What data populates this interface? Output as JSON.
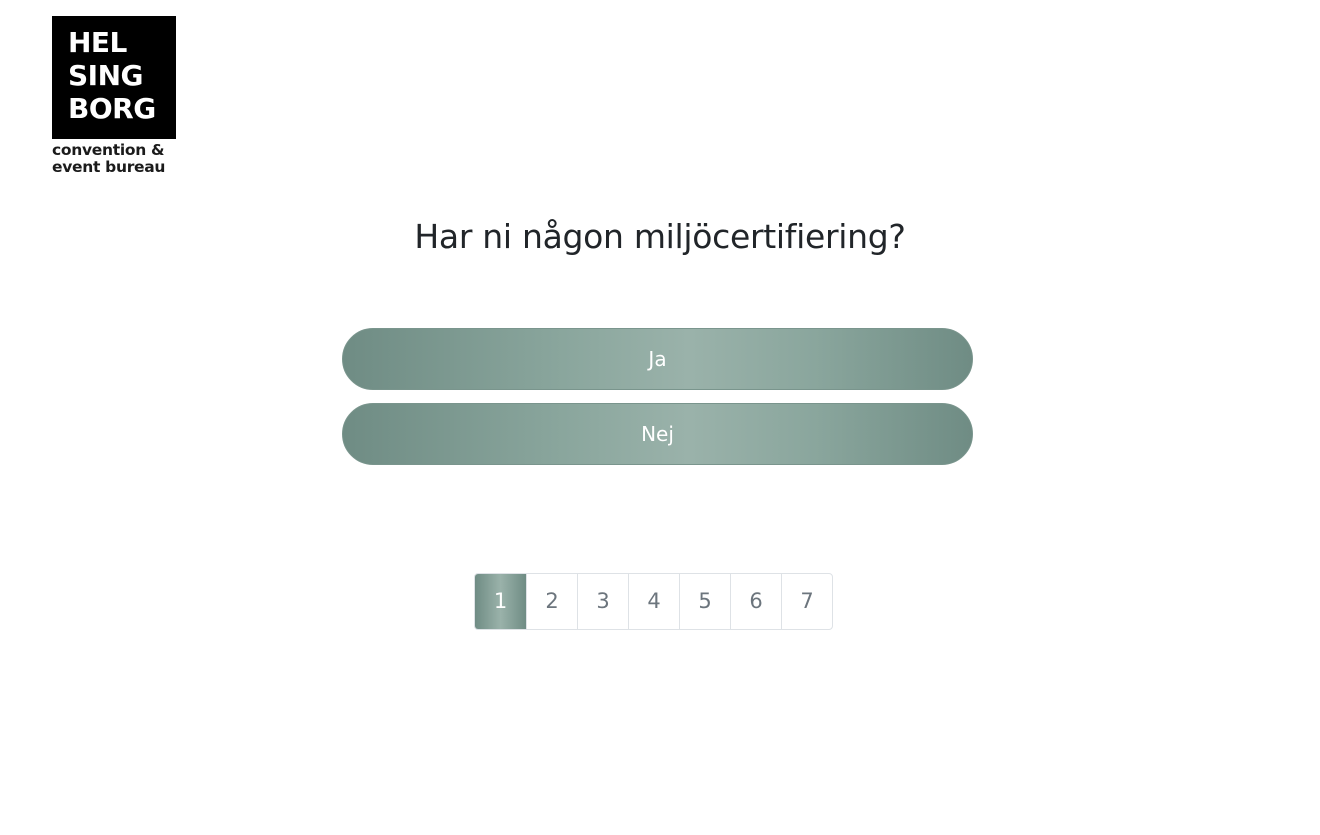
{
  "logo": {
    "lines": [
      "HEL",
      "SING",
      "BORG"
    ],
    "sub_lines": [
      "convention &",
      "event bureau"
    ]
  },
  "question": "Har ni någon miljöcertifiering?",
  "answers": [
    "Ja",
    "Nej"
  ],
  "pagination": {
    "pages": [
      "1",
      "2",
      "3",
      "4",
      "5",
      "6",
      "7"
    ],
    "active": "1"
  },
  "colors": {
    "accent": "#8aa69d",
    "accent_dark": "#6f8c84",
    "text": "#212529",
    "muted": "#6c757d"
  }
}
